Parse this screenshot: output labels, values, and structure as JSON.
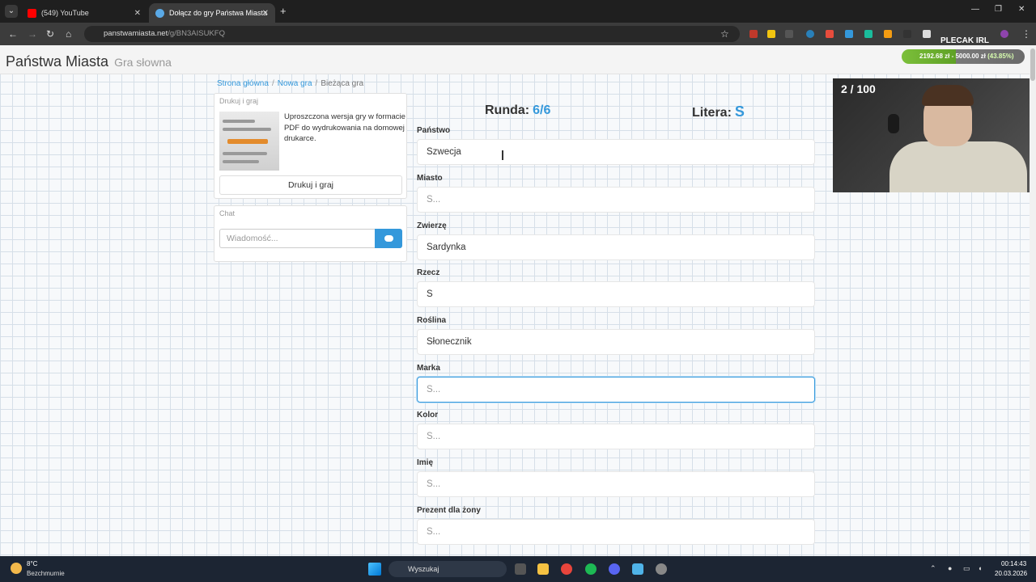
{
  "browser": {
    "tabs": [
      {
        "label": "(549) YouTube",
        "active": false,
        "favicon_color": "#ff0000"
      },
      {
        "label": "Dołącz do gry Państwa Miasta",
        "active": true,
        "favicon_color": "#5aa9e6"
      }
    ],
    "url_host": "panstwamiasta.net",
    "url_path": "/g/BN3AISUKFQ",
    "extension_label": "PLECAK IRL"
  },
  "site": {
    "brand": "Państwa Miasta",
    "brand_sub": "Gra słowna",
    "progress_text": "2192.68 zł - 5000.00 zł",
    "progress_pct": "(43.85%)"
  },
  "breadcrumb": [
    "Strona główna",
    "Nowa gra",
    "Bieżąca gra"
  ],
  "print_panel": {
    "title": "Drukuj i graj",
    "description": "Uproszczona wersja gry w formacie PDF do wydrukowania na domowej drukarce.",
    "button": "Drukuj i graj"
  },
  "chat_panel": {
    "title": "Chat",
    "placeholder": "Wiadomość..."
  },
  "game": {
    "round_label": "Runda:",
    "round_value": "6/6",
    "letter_label": "Litera:",
    "letter_value": "S",
    "fields": [
      {
        "label": "Państwo",
        "value": "Szwecja",
        "placeholder": "S..."
      },
      {
        "label": "Miasto",
        "value": "",
        "placeholder": "S..."
      },
      {
        "label": "Zwierzę",
        "value": "Sardynka",
        "placeholder": "S..."
      },
      {
        "label": "Rzecz",
        "value": "S",
        "placeholder": "S..."
      },
      {
        "label": "Roślina",
        "value": "Słonecznik",
        "placeholder": "S..."
      },
      {
        "label": "Marka",
        "value": "",
        "placeholder": "S..."
      },
      {
        "label": "Kolor",
        "value": "",
        "placeholder": "S..."
      },
      {
        "label": "Imię",
        "value": "",
        "placeholder": "S..."
      },
      {
        "label": "Prezent dla żony",
        "value": "",
        "placeholder": "S..."
      }
    ]
  },
  "overlay": {
    "counter": "2 / 100"
  },
  "taskbar": {
    "temperature": "8°C",
    "condition": "Bezchmurnie",
    "search": "Wyszukaj",
    "time": "00:14:43",
    "date": "20.03.2026"
  },
  "colors": {
    "accent": "#3498db",
    "taskbar": "#1c2533"
  }
}
